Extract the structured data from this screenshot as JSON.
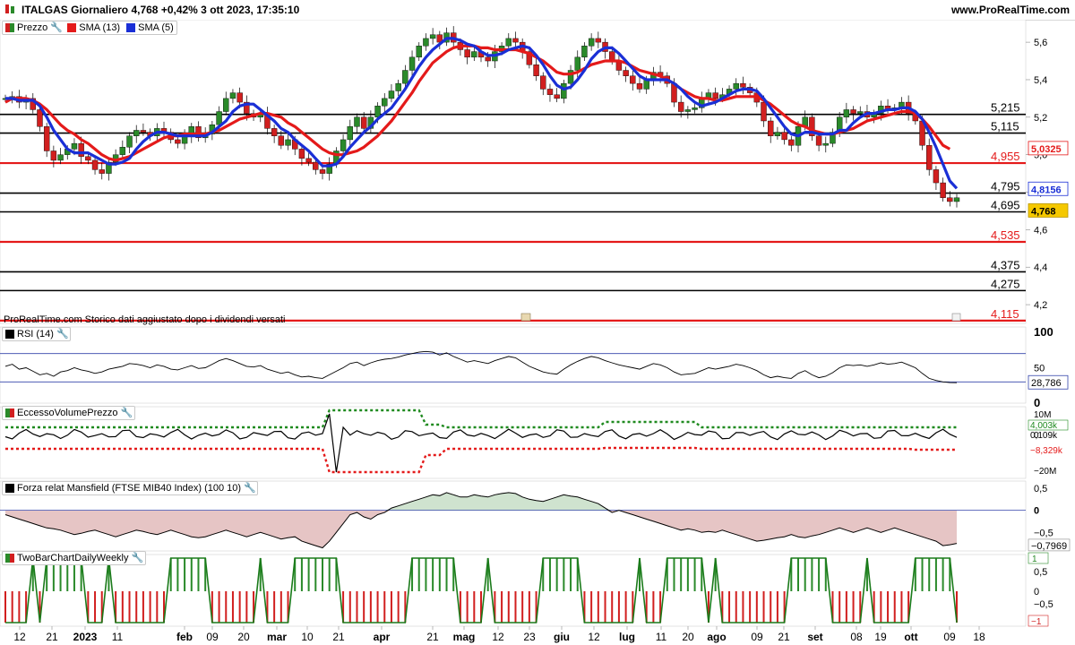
{
  "header": {
    "title": "ITALGAS Giornaliero 4,768 +0,42% 3 ott 2023, 17:35:10",
    "site": "www.ProRealTime.com",
    "note": "ProRealTime.com  Storico dati aggiustato dopo i dividendi versati"
  },
  "legends": {
    "price": "Prezzo",
    "sma13": "SMA (13)",
    "sma5": "SMA (5)",
    "rsi": "RSI (14)",
    "evp": "EccessoVolumePrezzo",
    "mansfield": "Forza relat Mansfield (FTSE MIB40 Index) (100 10)",
    "twobar": "TwoBarChartDailyWeekly"
  },
  "colors": {
    "up": "#2a8a2a",
    "down": "#d11f1f",
    "sma13": "#e41a1a",
    "sma5": "#1a2fd6",
    "levelBlack": "#000000",
    "levelRed": "#e41a1a",
    "mansfieldPos": "#cfe3cf",
    "mansfieldNeg": "#e6c5c5"
  },
  "chart_data": [
    {
      "type": "line",
      "id": "price",
      "title": "ITALGAS Giornaliero",
      "last_price": "4,768",
      "last_change": "+0,42%",
      "timestamp": "3 ott 2023, 17:35:10",
      "y_ticks": [
        "5,6",
        "5,4",
        "5,2",
        "5,0",
        "4,8",
        "4,6",
        "4,4",
        "4,2"
      ],
      "ylim": [
        4.1,
        5.72
      ],
      "x_ticks": [
        "12",
        "21",
        "2023",
        "11",
        "feb",
        "09",
        "20",
        "mar",
        "10",
        "21",
        "apr",
        "21",
        "mag",
        "12",
        "23",
        "giu",
        "12",
        "lug",
        "11",
        "20",
        "ago",
        "09",
        "21",
        "set",
        "08",
        "19",
        "ott",
        "09",
        "18"
      ],
      "closes": [
        5.3,
        5.31,
        5.28,
        5.3,
        5.24,
        5.15,
        5.02,
        4.97,
        5.0,
        5.03,
        5.06,
        4.99,
        4.97,
        4.92,
        4.9,
        4.96,
        5.0,
        5.04,
        5.1,
        5.13,
        5.12,
        5.1,
        5.14,
        5.12,
        5.08,
        5.06,
        5.1,
        5.15,
        5.09,
        5.11,
        5.16,
        5.23,
        5.3,
        5.33,
        5.28,
        5.22,
        5.2,
        5.22,
        5.14,
        5.1,
        5.05,
        5.08,
        5.03,
        4.98,
        4.96,
        4.92,
        4.9,
        4.95,
        5.02,
        5.08,
        5.15,
        5.2,
        5.14,
        5.2,
        5.26,
        5.3,
        5.34,
        5.38,
        5.45,
        5.52,
        5.58,
        5.62,
        5.64,
        5.6,
        5.65,
        5.6,
        5.56,
        5.52,
        5.55,
        5.52,
        5.5,
        5.55,
        5.58,
        5.62,
        5.6,
        5.55,
        5.48,
        5.42,
        5.35,
        5.32,
        5.3,
        5.38,
        5.45,
        5.52,
        5.58,
        5.62,
        5.6,
        5.55,
        5.5,
        5.45,
        5.42,
        5.38,
        5.35,
        5.4,
        5.44,
        5.42,
        5.38,
        5.28,
        5.23,
        5.24,
        5.25,
        5.3,
        5.33,
        5.3,
        5.32,
        5.35,
        5.38,
        5.36,
        5.33,
        5.28,
        5.18,
        5.1,
        5.12,
        5.08,
        5.05,
        5.15,
        5.2,
        5.1,
        5.05,
        5.06,
        5.12,
        5.2,
        5.24,
        5.22,
        5.23,
        5.2,
        5.22,
        5.26,
        5.24,
        5.25,
        5.28,
        5.22,
        5.18,
        5.05,
        4.92,
        4.85,
        4.77,
        4.75,
        4.77
      ],
      "sma13": [
        5.28,
        5.3,
        5.3,
        5.3,
        5.29,
        5.27,
        5.24,
        5.2,
        5.16,
        5.13,
        5.11,
        5.08,
        5.06,
        5.03,
        5.0,
        4.98,
        4.97,
        4.98,
        4.99,
        5.01,
        5.03,
        5.05,
        5.07,
        5.09,
        5.1,
        5.1,
        5.11,
        5.11,
        5.11,
        5.11,
        5.12,
        5.13,
        5.15,
        5.17,
        5.19,
        5.2,
        5.21,
        5.22,
        5.22,
        5.21,
        5.2,
        5.17,
        5.15,
        5.12,
        5.09,
        5.06,
        5.03,
        5.01,
        5.0,
        5.0,
        5.01,
        5.02,
        5.04,
        5.07,
        5.1,
        5.14,
        5.18,
        5.23,
        5.28,
        5.33,
        5.39,
        5.44,
        5.49,
        5.52,
        5.55,
        5.57,
        5.58,
        5.58,
        5.58,
        5.57,
        5.57,
        5.56,
        5.56,
        5.56,
        5.56,
        5.55,
        5.54,
        5.52,
        5.5,
        5.47,
        5.44,
        5.43,
        5.43,
        5.44,
        5.46,
        5.48,
        5.49,
        5.5,
        5.5,
        5.5,
        5.49,
        5.47,
        5.45,
        5.44,
        5.43,
        5.42,
        5.4,
        5.38,
        5.35,
        5.33,
        5.31,
        5.3,
        5.3,
        5.29,
        5.29,
        5.3,
        5.31,
        5.31,
        5.31,
        5.31,
        5.29,
        5.27,
        5.24,
        5.21,
        5.18,
        5.16,
        5.15,
        5.13,
        5.12,
        5.11,
        5.11,
        5.12,
        5.13,
        5.14,
        5.16,
        5.18,
        5.19,
        5.2,
        5.21,
        5.22,
        5.23,
        5.23,
        5.22,
        5.19,
        5.15,
        5.1,
        5.05,
        5.03
      ],
      "sma5": [
        5.3,
        5.3,
        5.29,
        5.29,
        5.29,
        5.26,
        5.2,
        5.13,
        5.08,
        5.03,
        5.01,
        5.01,
        5.01,
        4.99,
        4.97,
        4.95,
        4.95,
        4.96,
        4.98,
        5.03,
        5.07,
        5.1,
        5.12,
        5.12,
        5.11,
        5.1,
        5.1,
        5.1,
        5.1,
        5.1,
        5.12,
        5.15,
        5.18,
        5.23,
        5.26,
        5.27,
        5.27,
        5.24,
        5.21,
        5.18,
        5.14,
        5.12,
        5.08,
        5.05,
        5.02,
        4.98,
        4.94,
        4.94,
        4.95,
        4.99,
        5.04,
        5.08,
        5.12,
        5.15,
        5.19,
        5.22,
        5.25,
        5.3,
        5.35,
        5.41,
        5.47,
        5.52,
        5.56,
        5.59,
        5.62,
        5.62,
        5.61,
        5.59,
        5.58,
        5.55,
        5.53,
        5.53,
        5.54,
        5.56,
        5.57,
        5.58,
        5.57,
        5.53,
        5.48,
        5.42,
        5.37,
        5.35,
        5.36,
        5.4,
        5.45,
        5.51,
        5.55,
        5.57,
        5.57,
        5.54,
        5.5,
        5.46,
        5.42,
        5.4,
        5.4,
        5.4,
        5.4,
        5.38,
        5.35,
        5.31,
        5.28,
        5.26,
        5.27,
        5.28,
        5.3,
        5.32,
        5.34,
        5.35,
        5.35,
        5.34,
        5.3,
        5.25,
        5.2,
        5.15,
        5.11,
        5.1,
        5.12,
        5.12,
        5.11,
        5.11,
        5.11,
        5.13,
        5.13,
        5.17,
        5.2,
        5.22,
        5.22,
        5.23,
        5.24,
        5.24,
        5.25,
        5.25,
        5.23,
        5.19,
        5.12,
        5.04,
        4.95,
        4.86,
        4.82
      ],
      "levels_black": [
        "5,215",
        "5,115",
        "4,795",
        "4,695",
        "4,375",
        "4,275"
      ],
      "levels_red": [
        "4,955",
        "4,535",
        "4,115"
      ],
      "tags": {
        "sma13": "5,0325",
        "sma5": "4,8156",
        "last": "4,768"
      }
    },
    {
      "type": "line",
      "id": "rsi",
      "title": "RSI (14)",
      "y_ticks": [
        "100",
        "50",
        "0"
      ],
      "ylim": [
        0,
        100
      ],
      "overbought": 70,
      "oversold": 30,
      "last": "28,786",
      "values": [
        52,
        55,
        48,
        50,
        45,
        40,
        42,
        38,
        44,
        46,
        50,
        47,
        45,
        42,
        44,
        48,
        50,
        52,
        56,
        55,
        53,
        50,
        54,
        52,
        48,
        47,
        50,
        53,
        49,
        50,
        55,
        60,
        63,
        60,
        56,
        52,
        51,
        53,
        48,
        45,
        42,
        44,
        40,
        37,
        38,
        36,
        35,
        40,
        45,
        50,
        56,
        58,
        53,
        57,
        60,
        62,
        63,
        65,
        68,
        70,
        72,
        73,
        72,
        68,
        71,
        66,
        62,
        58,
        60,
        58,
        56,
        60,
        63,
        66,
        64,
        58,
        52,
        48,
        44,
        42,
        41,
        48,
        54,
        59,
        63,
        66,
        64,
        60,
        57,
        54,
        52,
        50,
        48,
        52,
        56,
        54,
        50,
        44,
        40,
        41,
        42,
        46,
        50,
        48,
        50,
        52,
        55,
        53,
        50,
        46,
        40,
        36,
        38,
        36,
        35,
        42,
        46,
        40,
        36,
        38,
        43,
        50,
        54,
        53,
        54,
        52,
        54,
        57,
        55,
        56,
        58,
        54,
        50,
        42,
        35,
        32,
        30,
        29,
        28.8
      ]
    },
    {
      "type": "line",
      "id": "eccesso_volume_prezzo",
      "title": "EccessoVolumePrezzo",
      "y_ticks": [
        "10M",
        "0",
        "−20M"
      ],
      "labels": {
        "upper": "4,003k",
        "mid": "0,109k",
        "lower": "−8,329k"
      }
    },
    {
      "type": "area",
      "id": "mansfield",
      "title": "Forza relat Mansfield (FTSE MIB40 Index) (100 10)",
      "y_ticks": [
        "0,5",
        "0",
        "−0,5"
      ],
      "ylim": [
        -0.9,
        0.6
      ],
      "last": "−0,7969",
      "values": [
        -0.1,
        -0.15,
        -0.2,
        -0.25,
        -0.3,
        -0.35,
        -0.4,
        -0.42,
        -0.45,
        -0.5,
        -0.55,
        -0.52,
        -0.48,
        -0.45,
        -0.5,
        -0.55,
        -0.6,
        -0.55,
        -0.5,
        -0.45,
        -0.48,
        -0.52,
        -0.55,
        -0.5,
        -0.45,
        -0.5,
        -0.55,
        -0.6,
        -0.62,
        -0.6,
        -0.55,
        -0.5,
        -0.45,
        -0.5,
        -0.55,
        -0.6,
        -0.55,
        -0.5,
        -0.55,
        -0.6,
        -0.65,
        -0.62,
        -0.6,
        -0.7,
        -0.75,
        -0.8,
        -0.85,
        -0.7,
        -0.5,
        -0.3,
        -0.1,
        -0.05,
        -0.15,
        -0.2,
        -0.1,
        -0.05,
        0.05,
        0.1,
        0.15,
        0.2,
        0.25,
        0.3,
        0.35,
        0.33,
        0.4,
        0.35,
        0.3,
        0.3,
        0.35,
        0.32,
        0.3,
        0.35,
        0.38,
        0.4,
        0.38,
        0.3,
        0.25,
        0.22,
        0.2,
        0.25,
        0.3,
        0.35,
        0.32,
        0.3,
        0.25,
        0.2,
        0.15,
        0.05,
        -0.05,
        0.0,
        -0.05,
        -0.1,
        -0.15,
        -0.2,
        -0.25,
        -0.3,
        -0.35,
        -0.4,
        -0.45,
        -0.42,
        -0.45,
        -0.5,
        -0.48,
        -0.5,
        -0.45,
        -0.5,
        -0.55,
        -0.6,
        -0.65,
        -0.7,
        -0.68,
        -0.65,
        -0.62,
        -0.6,
        -0.55,
        -0.6,
        -0.62,
        -0.58,
        -0.55,
        -0.5,
        -0.45,
        -0.4,
        -0.45,
        -0.5,
        -0.45,
        -0.4,
        -0.45,
        -0.5,
        -0.45,
        -0.4,
        -0.45,
        -0.5,
        -0.55,
        -0.6,
        -0.65,
        -0.7,
        -0.8,
        -0.78,
        -0.75
      ]
    },
    {
      "type": "bar",
      "id": "twobar",
      "title": "TwoBarChartDailyWeekly",
      "y_ticks": [
        "1",
        "0,5",
        "0",
        "−0,5",
        "−1"
      ],
      "labels": {
        "top": "1",
        "bottom": "−1"
      }
    }
  ]
}
